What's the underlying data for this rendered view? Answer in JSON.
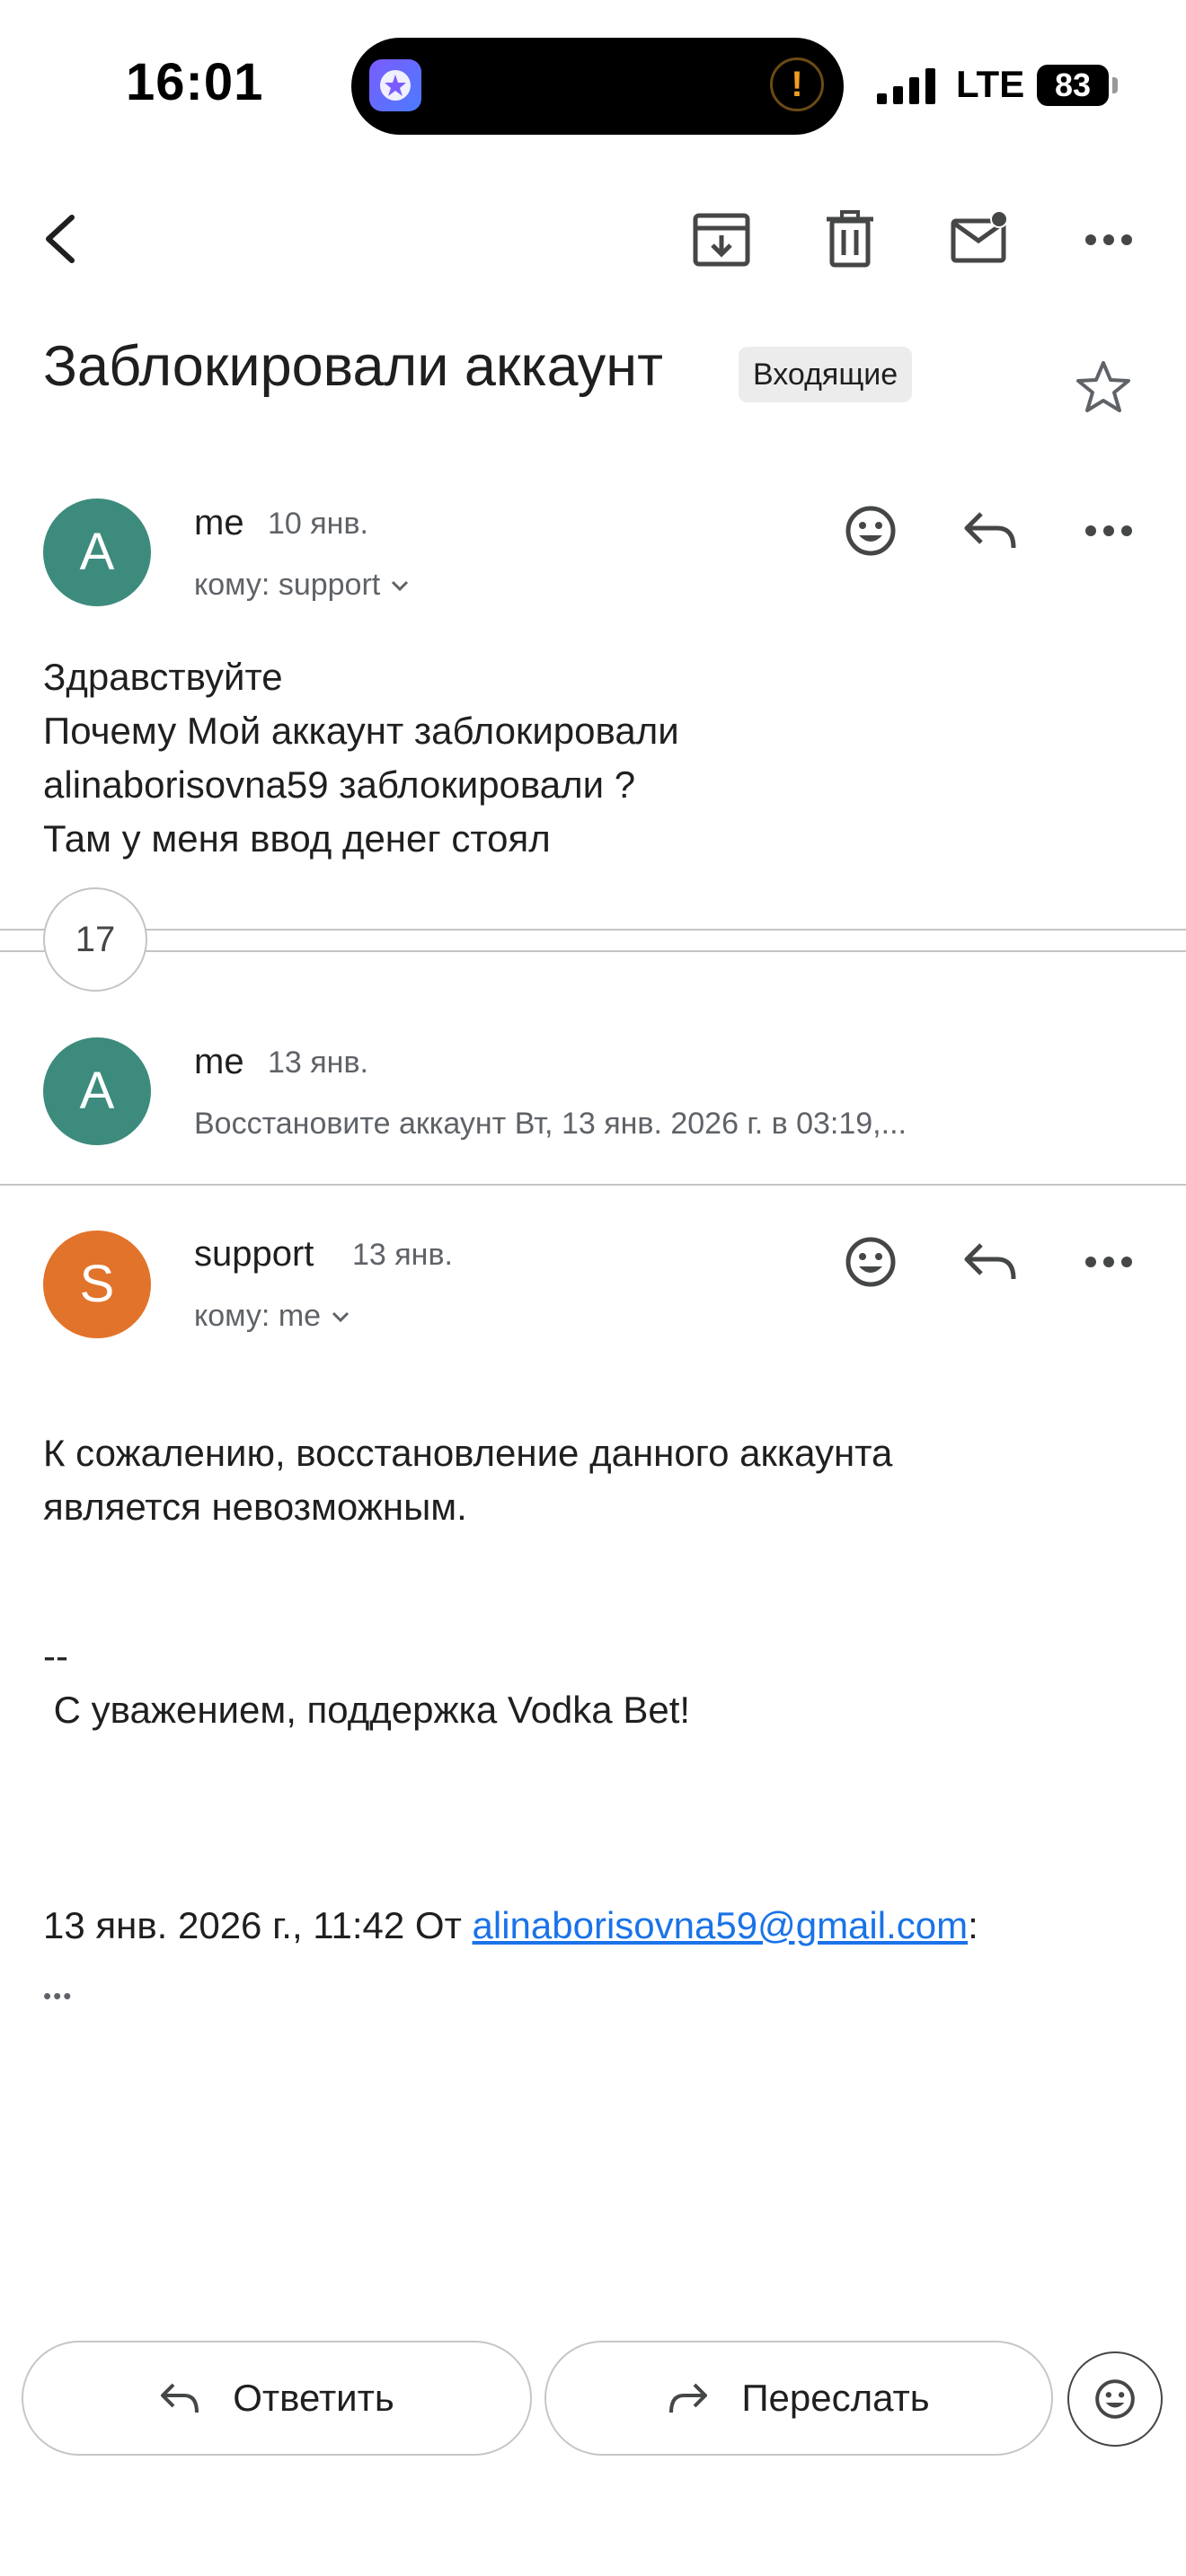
{
  "status_bar": {
    "time": "16:01",
    "network": "LTE",
    "battery": "83"
  },
  "toolbar": {
    "back_icon": "back-arrow-icon",
    "archive_icon": "archive-icon",
    "delete_icon": "trash-icon",
    "mark_unread_icon": "mail-unread-icon",
    "more_icon": "more-horizontal-icon"
  },
  "thread": {
    "subject": "Заблокировали аккаунт",
    "label": "Входящие",
    "collapsed_count": "17"
  },
  "messages": [
    {
      "avatar_letter": "A",
      "sender": "me",
      "date": "10 янв.",
      "to": "кому: support",
      "body": [
        "Здравствуйте",
        "Почему Мой аккаунт заблокировали",
        "alinaborisovna59 заблокировали ?",
        "Там у меня ввод денег стоял"
      ]
    },
    {
      "avatar_letter": "A",
      "sender": "me",
      "date": "13 янв.",
      "snippet": "Восстановите аккаунт Вт, 13 янв. 2026 г. в 03:19,..."
    },
    {
      "avatar_letter": "S",
      "sender": "support",
      "date": "13 янв.",
      "to": "кому: me",
      "body": [
        "К сожалению, восстановление данного аккаунта",
        "является невозможным."
      ],
      "signature_dash": "--",
      "signature": " С уважением, поддержка Vodka Bet!",
      "quote_prefix": "13 янв. 2026 г., 11:42 От ",
      "quote_email": "alinaborisovna59@gmail.com",
      "quote_suffix": ":",
      "trimmed": "•••"
    }
  ],
  "actions": {
    "reply": "Ответить",
    "forward": "Переслать"
  },
  "colors": {
    "avatar_me": "#3d8b7d",
    "avatar_support": "#e2732a",
    "link": "#1a73e8"
  }
}
